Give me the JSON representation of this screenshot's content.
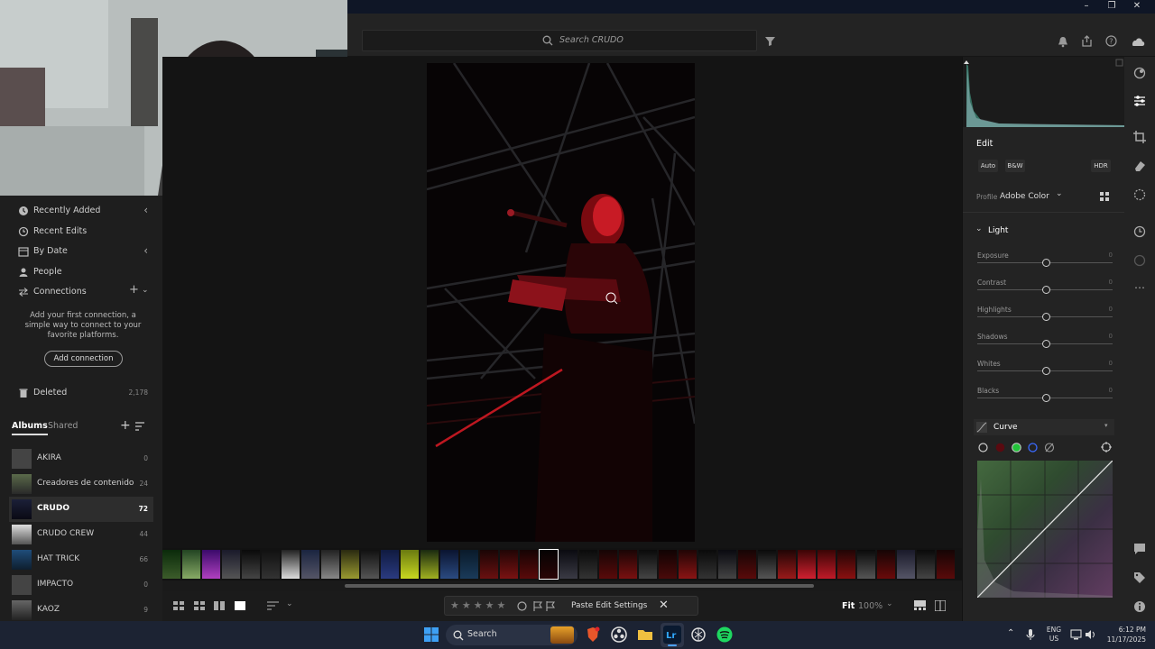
{
  "toolbar": {
    "search_placeholder": "Search CRUDO"
  },
  "sidebar": {
    "nav": [
      {
        "label": "Recently Added"
      },
      {
        "label": "Recent Edits"
      },
      {
        "label": "By Date"
      },
      {
        "label": "People"
      },
      {
        "label": "Connections"
      }
    ],
    "connection_hint": "Add your first connection, a simple way to connect to your favorite platforms.",
    "add_connection_label": "Add connection",
    "deleted": {
      "label": "Deleted",
      "count": "2,178"
    },
    "tabs": {
      "albums": "Albums",
      "shared": "Shared"
    },
    "albums": [
      {
        "name": "AKIRA",
        "count": "0"
      },
      {
        "name": "Creadores de contenido",
        "count": "24"
      },
      {
        "name": "CRUDO",
        "count": "72"
      },
      {
        "name": "CRUDO CREW",
        "count": "44"
      },
      {
        "name": "HAT TRICK",
        "count": "66"
      },
      {
        "name": "IMPACTO",
        "count": "0"
      },
      {
        "name": "KAOZ",
        "count": "9"
      }
    ]
  },
  "bottombar": {
    "paste_label": "Paste Edit Settings",
    "fit_label": "Fit",
    "zoom": "100%"
  },
  "edit": {
    "title": "Edit",
    "auto": "Auto",
    "bw": "B&W",
    "hdr": "HDR",
    "profile_label": "Profile",
    "profile_value": "Adobe Color",
    "light_label": "Light",
    "sliders": [
      {
        "label": "Exposure",
        "value": "0"
      },
      {
        "label": "Contrast",
        "value": "0"
      },
      {
        "label": "Highlights",
        "value": "0"
      },
      {
        "label": "Shadows",
        "value": "0"
      },
      {
        "label": "Whites",
        "value": "0"
      },
      {
        "label": "Blacks",
        "value": "0"
      }
    ],
    "curve_label": "Curve"
  },
  "taskbar": {
    "search_label": "Search",
    "lang": "ENG",
    "region": "US",
    "time": "6:12 PM",
    "date": "11/17/2025"
  },
  "colors": {
    "accent_blue": "#2d6bd8",
    "panel": "#232323",
    "photo_red": "#d11a24"
  }
}
